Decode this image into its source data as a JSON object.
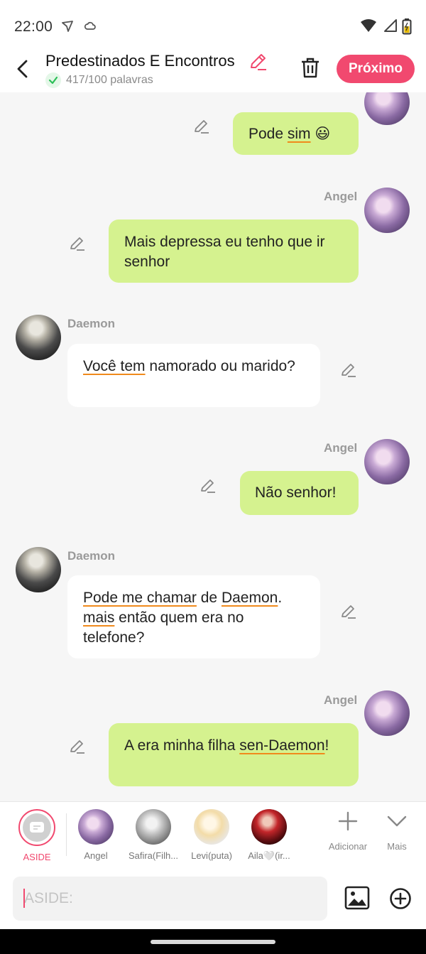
{
  "status_bar": {
    "time": "22:00"
  },
  "header": {
    "title": "Predestinados E Encontros",
    "word_count": "417/100 palavras",
    "next_label": "Próximo"
  },
  "messages": [
    {
      "sender": "Angel",
      "text": "Pode sim 😃"
    },
    {
      "sender": "Angel",
      "text": "Mais depressa eu tenho que ir senhor"
    },
    {
      "sender": "Daemon",
      "text": "Você tem namorado ou marido?"
    },
    {
      "sender": "Angel",
      "text": "Não senhor!"
    },
    {
      "sender": "Daemon",
      "text": "Pode me chamar de Daemon. mais então quem era no telefone?"
    },
    {
      "sender": "Angel",
      "text": "A era minha filha sen-Daemon!"
    }
  ],
  "characters": [
    {
      "label": "ASIDE"
    },
    {
      "label": "Angel"
    },
    {
      "label": "Safira(Filh..."
    },
    {
      "label": "Levi(puta)"
    },
    {
      "label": "Aila🤍(ir..."
    }
  ],
  "tools": {
    "add_label": "Adicionar",
    "more_label": "Mais"
  },
  "input": {
    "placeholder": "ASIDE:"
  },
  "colors": {
    "accent": "#f1496f",
    "outgoing_bubble": "#d5f28f",
    "incoming_bubble": "#ffffff",
    "underline": "#f08a1c"
  }
}
